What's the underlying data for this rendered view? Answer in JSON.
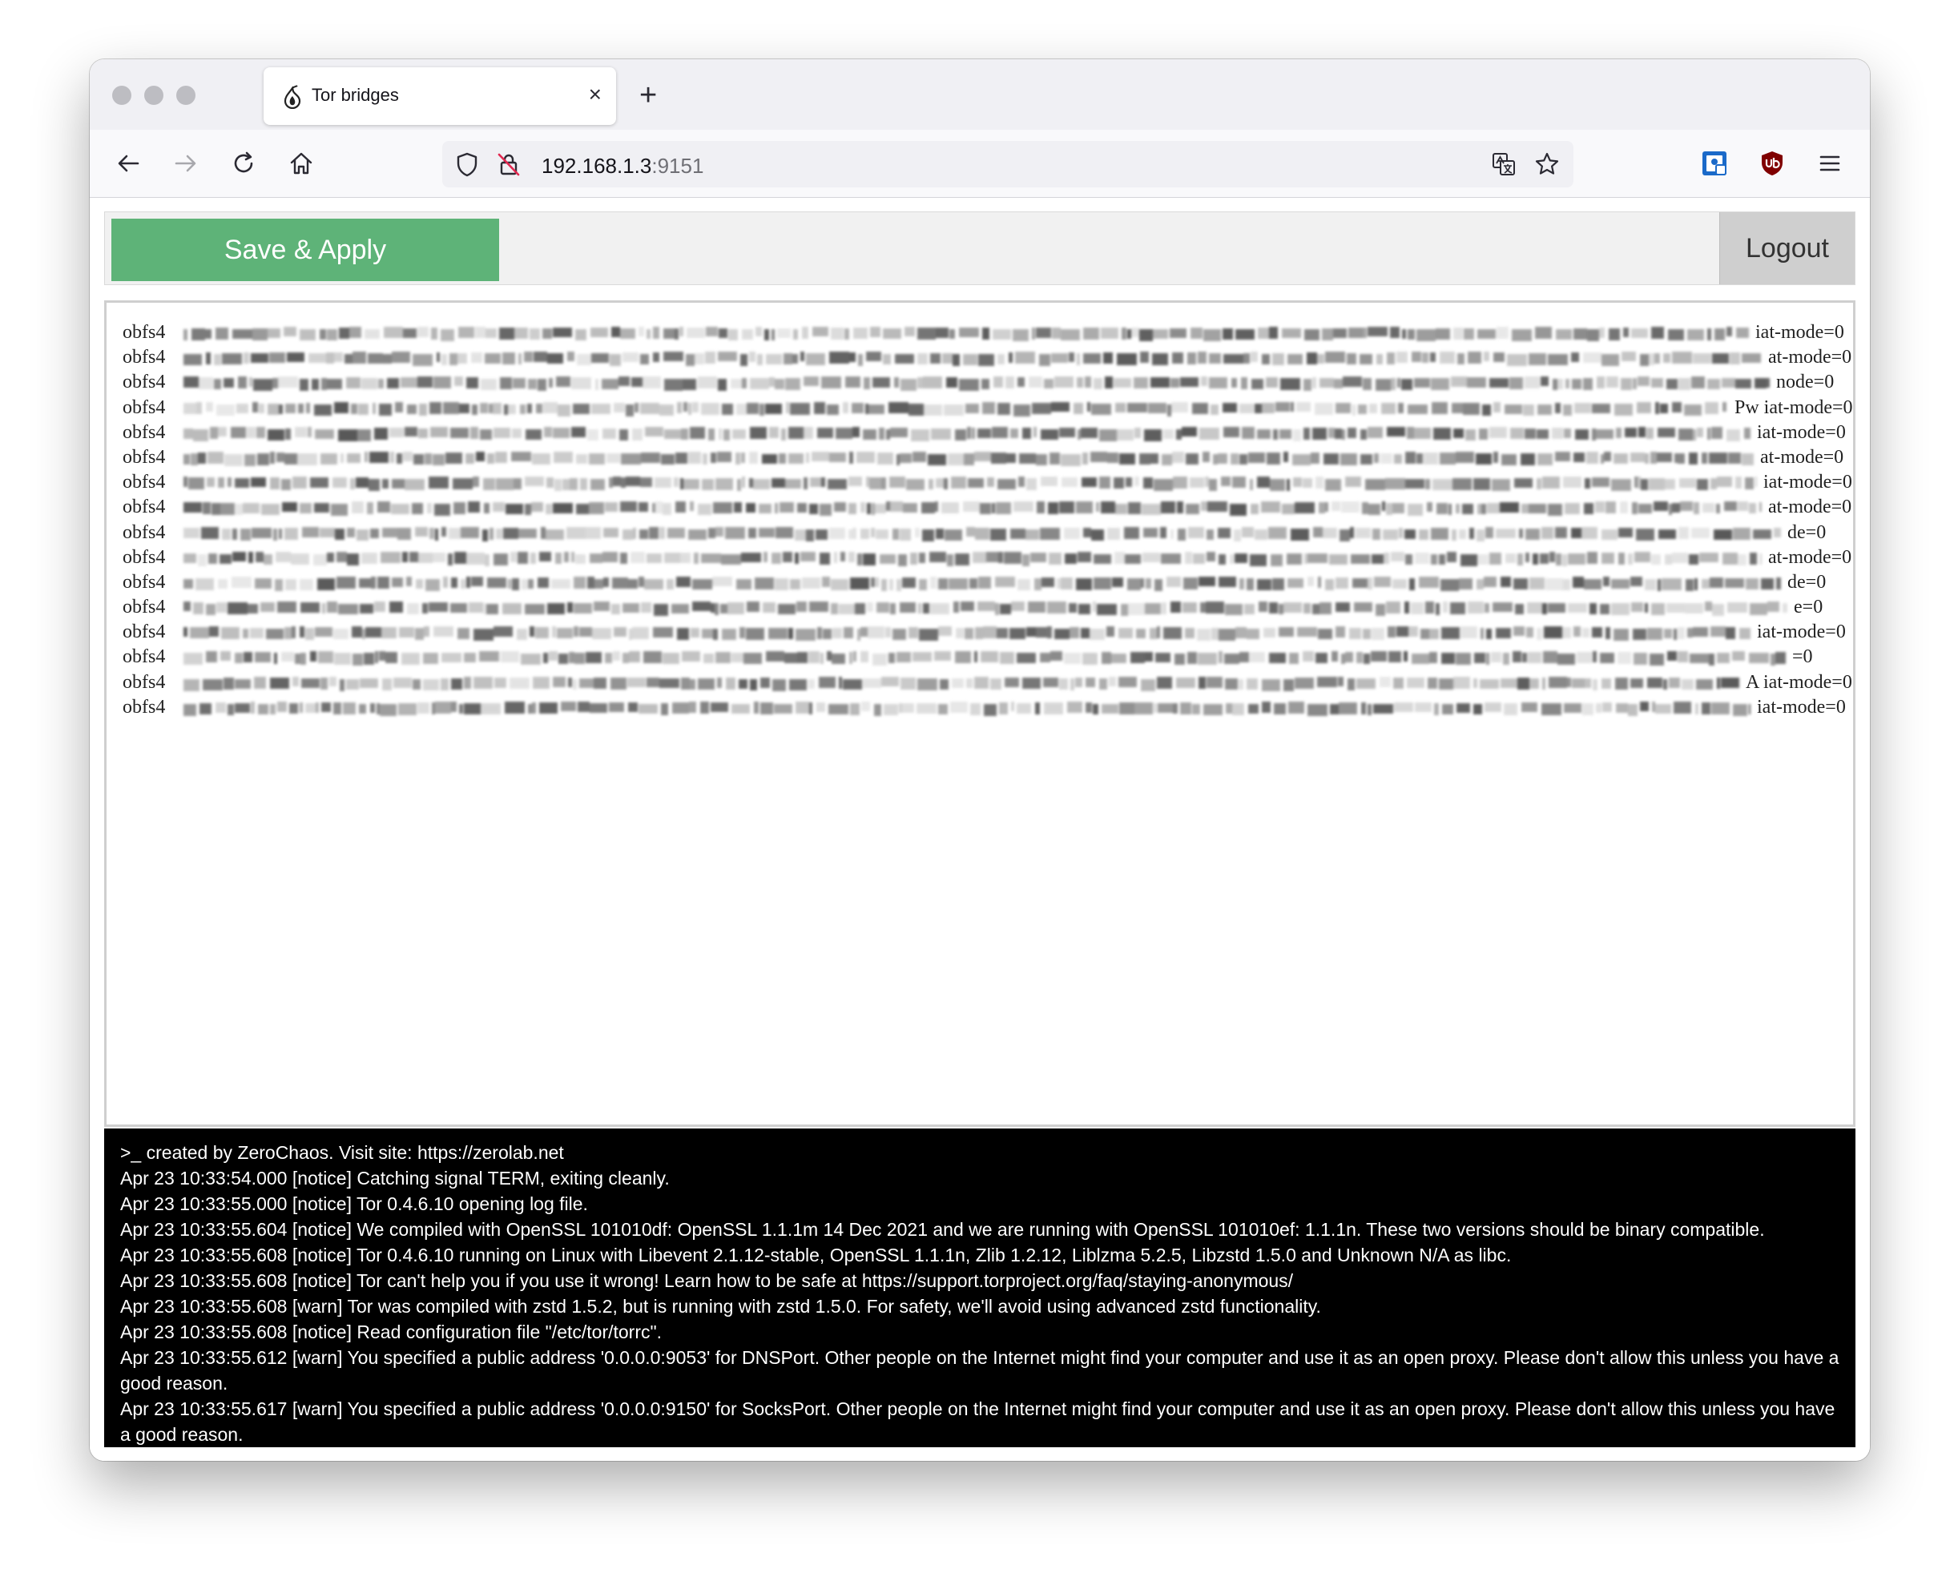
{
  "browser": {
    "tab_title": "Tor bridges",
    "tab_close": "×",
    "new_tab": "+",
    "url_host": "192.168.1.3",
    "url_port": ":9151"
  },
  "toolbar": {
    "save_label": "Save & Apply",
    "logout_label": "Logout"
  },
  "colors": {
    "save_button": "#5eb378",
    "console_background": "#000000"
  },
  "bridges": [
    {
      "proto": "obfs4",
      "tail": "iat-mode=0"
    },
    {
      "proto": "obfs4",
      "tail": "at-mode=0"
    },
    {
      "proto": "obfs4",
      "tail": "node=0"
    },
    {
      "proto": "obfs4",
      "tail": "Pw iat-mode=0"
    },
    {
      "proto": "obfs4",
      "tail": "iat-mode=0"
    },
    {
      "proto": "obfs4",
      "tail": "at-mode=0"
    },
    {
      "proto": "obfs4",
      "tail": "iat-mode=0"
    },
    {
      "proto": "obfs4",
      "tail": "at-mode=0"
    },
    {
      "proto": "obfs4",
      "tail": "de=0"
    },
    {
      "proto": "obfs4",
      "tail": "at-mode=0"
    },
    {
      "proto": "obfs4",
      "tail": "de=0"
    },
    {
      "proto": "obfs4",
      "tail": "e=0"
    },
    {
      "proto": "obfs4",
      "tail": "iat-mode=0"
    },
    {
      "proto": "obfs4",
      "tail": "=0"
    },
    {
      "proto": "obfs4",
      "tail": "A iat-mode=0"
    },
    {
      "proto": "obfs4",
      "tail": "iat-mode=0"
    }
  ],
  "console": {
    "lines": [
      ">_ created by ZeroChaos. Visit site: https://zerolab.net",
      "Apr 23 10:33:54.000 [notice] Catching signal TERM, exiting cleanly.",
      "Apr 23 10:33:55.000 [notice] Tor 0.4.6.10 opening log file.",
      "Apr 23 10:33:55.604 [notice] We compiled with OpenSSL 101010df: OpenSSL 1.1.1m 14 Dec 2021 and we are running with OpenSSL 101010ef: 1.1.1n. These two versions should be binary compatible.",
      "Apr 23 10:33:55.608 [notice] Tor 0.4.6.10 running on Linux with Libevent 2.1.12-stable, OpenSSL 1.1.1n, Zlib 1.2.12, Liblzma 5.2.5, Libzstd 1.5.0 and Unknown N/A as libc.",
      "Apr 23 10:33:55.608 [notice] Tor can't help you if you use it wrong! Learn how to be safe at https://support.torproject.org/faq/staying-anonymous/",
      "Apr 23 10:33:55.608 [warn] Tor was compiled with zstd 1.5.2, but is running with zstd 1.5.0. For safety, we'll avoid using advanced zstd functionality.",
      "Apr 23 10:33:55.608 [notice] Read configuration file \"/etc/tor/torrc\".",
      "Apr 23 10:33:55.612 [warn] You specified a public address '0.0.0.0:9053' for DNSPort. Other people on the Internet might find your computer and use it as an open proxy. Please don't allow this unless you have a good reason.",
      "Apr 23 10:33:55.617 [warn] You specified a public address '0.0.0.0:9150' for SocksPort. Other people on the Internet might find your computer and use it as an open proxy. Please don't allow this unless you have a good reason."
    ]
  }
}
